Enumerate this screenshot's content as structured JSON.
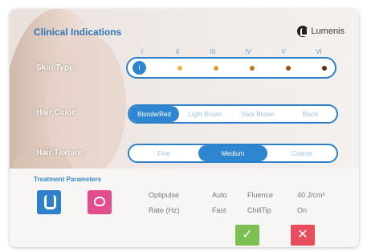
{
  "header": {
    "title": "Clinical Indications",
    "brand": "Lumenis"
  },
  "skin_type": {
    "label": "Skin Type:",
    "types": [
      "I",
      "II",
      "III",
      "IV",
      "V",
      "VI"
    ],
    "selected_index": 0,
    "dot_colors": [
      "#2f86d0",
      "#f0b04a",
      "#e39a2f",
      "#c8721e",
      "#9a4e14",
      "#6b2b0c"
    ]
  },
  "hair_color": {
    "label": "Hair Color:",
    "options": [
      "Blonde/Red",
      "Light Brown",
      "Dark Brown",
      "Black"
    ],
    "selected_index": 0
  },
  "hair_texture": {
    "label": "Hair Texture:",
    "options": [
      "Fine",
      "Medium",
      "Coarse"
    ],
    "selected_index": 1
  },
  "parameters": {
    "title": "Treatment Parameters",
    "rows": [
      [
        "Optipulse",
        "Auto",
        "Fluence",
        "40 J/cm²"
      ],
      [
        "Rate (Hz)",
        "Fast",
        "ChillTip",
        "On"
      ]
    ]
  },
  "actions": {
    "confirm_symbol": "✓",
    "cancel_symbol": "✕"
  },
  "colors": {
    "accent": "#2e80c8",
    "confirm": "#7cc052",
    "cancel": "#e94c5d",
    "mode_b": "#e34d8e"
  }
}
